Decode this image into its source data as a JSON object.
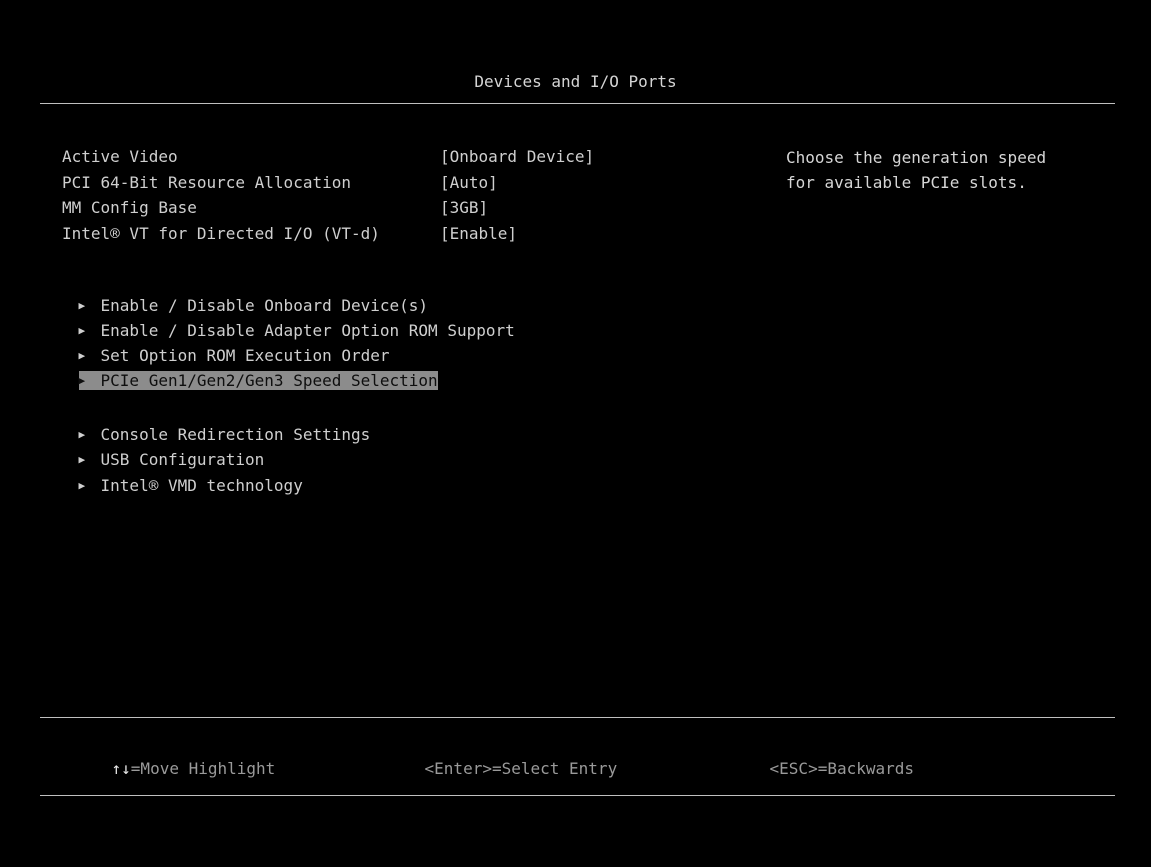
{
  "header": {
    "title": "Devices and I/O Ports"
  },
  "settings": [
    {
      "label": "Active Video",
      "value": "[Onboard Device]"
    },
    {
      "label": "PCI 64-Bit Resource Allocation",
      "value": "[Auto]"
    },
    {
      "label": "MM Config Base",
      "value": "[3GB]"
    },
    {
      "label": "Intel® VT for Directed I/O (VT-d)",
      "value": "[Enable]"
    }
  ],
  "submenus_group1": [
    {
      "label": "Enable / Disable Onboard Device(s)"
    },
    {
      "label": "Enable / Disable Adapter Option ROM Support"
    },
    {
      "label": "Set Option ROM Execution Order"
    },
    {
      "label": "PCIe Gen1/Gen2/Gen3 Speed Selection",
      "selected": true
    }
  ],
  "submenus_group2": [
    {
      "label": "Console Redirection Settings"
    },
    {
      "label": "USB Configuration"
    },
    {
      "label": "Intel® VMD technology"
    }
  ],
  "help": {
    "text": "Choose the generation speed\nfor available PCIe slots."
  },
  "footer": {
    "move_key": "↑↓",
    "move_label": "=Move Highlight",
    "select_key": "<Enter>",
    "select_label": "=Select Entry",
    "back_key": "<ESC>",
    "back_label": "=Backwards"
  },
  "colors": {
    "background": "#000000",
    "text": "#cfcfcf",
    "highlight_bg": "#8c8c8c",
    "highlight_text": "#0e0e0e"
  }
}
